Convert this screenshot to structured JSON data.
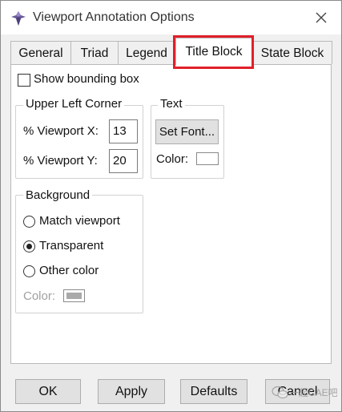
{
  "window": {
    "title": "Viewport Annotation Options",
    "close_glyph": "✕",
    "app_icon": "abaqus-logo-icon",
    "close_icon": "close-icon"
  },
  "tabs": [
    {
      "label": "General",
      "active": false
    },
    {
      "label": "Triad",
      "active": false
    },
    {
      "label": "Legend",
      "active": false
    },
    {
      "label": "Title Block",
      "active": true
    },
    {
      "label": "State Block",
      "active": false
    }
  ],
  "highlight_color": "#e0202a",
  "panel": {
    "show_bounding_box": {
      "label": "Show bounding box",
      "checked": false
    },
    "upper_left_corner": {
      "title": "Upper Left Corner",
      "viewport_x": {
        "label": "% Viewport X:",
        "value": "13"
      },
      "viewport_y": {
        "label": "% Viewport Y:",
        "value": "20"
      }
    },
    "text": {
      "title": "Text",
      "set_font_label": "Set Font...",
      "color_label": "Color:",
      "color_value": "#ffffff"
    },
    "background": {
      "title": "Background",
      "options": [
        {
          "label": "Match viewport",
          "selected": false
        },
        {
          "label": "Transparent",
          "selected": true
        },
        {
          "label": "Other color",
          "selected": false
        }
      ],
      "color_label": "Color:",
      "color_value": "#a9a9a9",
      "color_enabled": false
    }
  },
  "buttons": {
    "ok": "OK",
    "apply": "Apply",
    "defaults": "Defaults",
    "cancel": "Cancel"
  },
  "watermark": {
    "text": "一起CAE吧",
    "icon": "wechat-icon"
  }
}
